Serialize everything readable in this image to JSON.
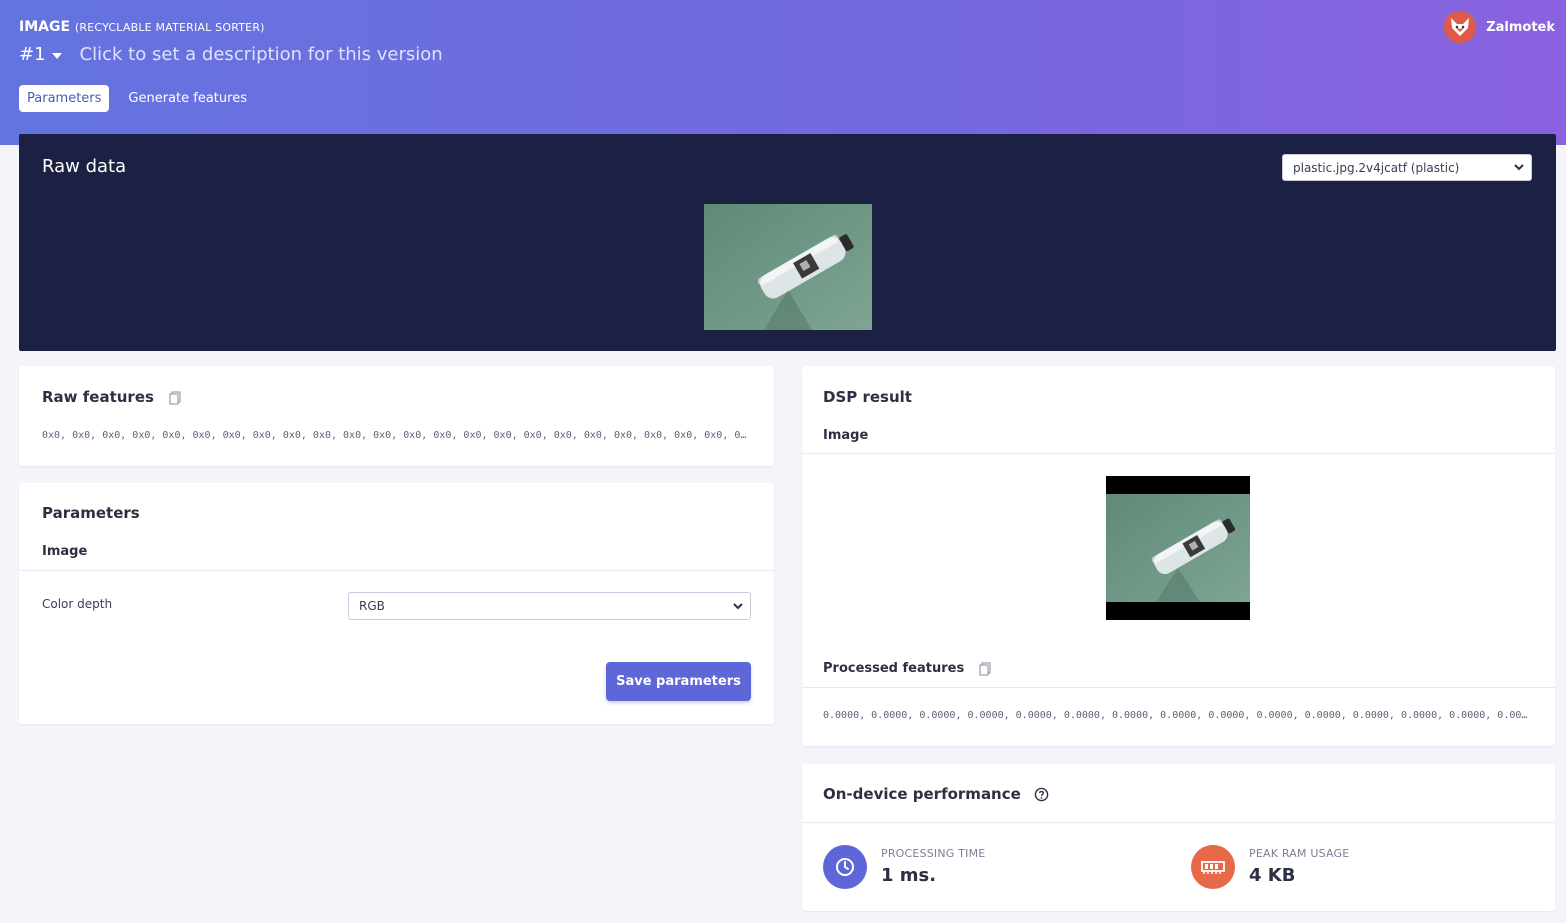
{
  "header": {
    "project_type": "IMAGE",
    "project_name": "(RECYCLABLE MATERIAL SORTER)",
    "version": "#1",
    "version_description": "Click to set a description for this version",
    "tabs": [
      {
        "label": "Parameters",
        "active": true
      },
      {
        "label": "Generate features",
        "active": false
      }
    ],
    "user": {
      "name": "Zalmotek",
      "avatar_icon": "fox-avatar-icon"
    }
  },
  "raw_data": {
    "title": "Raw data",
    "sample_select": {
      "value": "plastic.jpg.2v4jcatf (plastic)"
    },
    "image_icon": "plastic-bottle-photo"
  },
  "raw_features": {
    "title": "Raw features",
    "values": "0x0, 0x0, 0x0, 0x0, 0x0, 0x0, 0x0, 0x0, 0x0, 0x0, 0x0, 0x0, 0x0, 0x0, 0x0, 0x0, 0x0, 0x0, 0x0, 0x0, 0x0, 0x0, 0x0, 0x0, 0x0"
  },
  "parameters": {
    "title": "Parameters",
    "section": "Image",
    "color_depth_label": "Color depth",
    "color_depth_value": "RGB",
    "save_label": "Save parameters"
  },
  "dsp_result": {
    "title": "DSP result",
    "section": "Image",
    "processed_title": "Processed features",
    "processed_values": "0.0000, 0.0000, 0.0000, 0.0000, 0.0000, 0.0000, 0.0000, 0.0000, 0.0000, 0.0000, 0.0000, 0.0000, 0.0000, 0.0000, 0.0000, 0.0000"
  },
  "performance": {
    "title": "On-device performance",
    "processing_time_label": "PROCESSING TIME",
    "processing_time_value": "1 ms.",
    "peak_ram_label": "PEAK RAM USAGE",
    "peak_ram_value": "4 KB"
  },
  "colors": {
    "accent": "#5d67d8",
    "header_gradient_start": "#6474df",
    "header_gradient_end": "#8a62df",
    "raw_panel_bg": "#1c2042",
    "ram_icon_bg": "#e8684a"
  }
}
